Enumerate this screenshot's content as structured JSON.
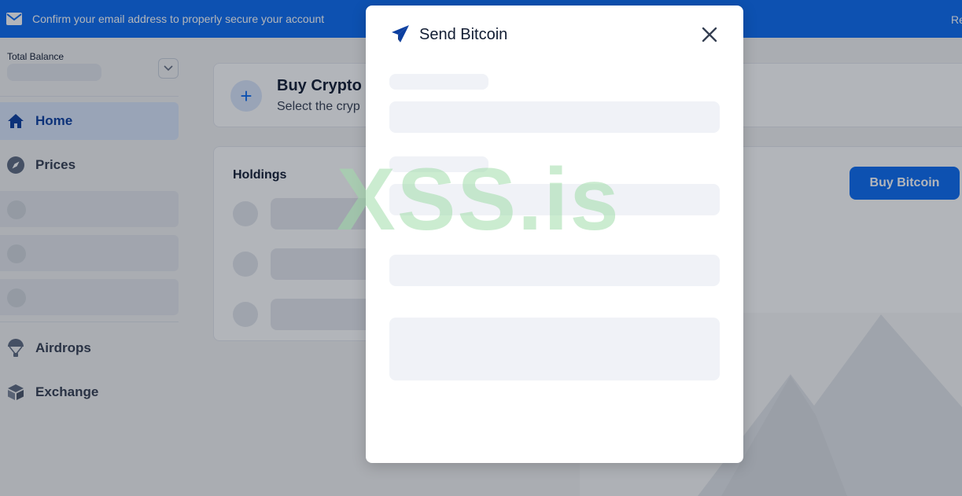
{
  "banner": {
    "message": "Confirm your email address to properly secure your account",
    "right_text": "Re"
  },
  "sidebar": {
    "total_balance_label": "Total Balance",
    "items": [
      {
        "label": "Home",
        "icon": "home-icon",
        "active": true
      },
      {
        "label": "Prices",
        "icon": "compass-icon",
        "active": false
      },
      {
        "label": "Airdrops",
        "icon": "parachute-icon",
        "active": false
      },
      {
        "label": "Exchange",
        "icon": "exchange-icon",
        "active": false
      }
    ]
  },
  "main": {
    "buy_card": {
      "title": "Buy Crypto",
      "subtitle": "Select the cryp"
    },
    "holdings": {
      "title": "Holdings"
    },
    "buy_bitcoin_label": "Buy Bitcoin"
  },
  "modal": {
    "title": "Send Bitcoin",
    "icon": "paper-plane-icon",
    "close_icon": "close-icon"
  },
  "watermark": "XSS.is",
  "colors": {
    "brand_blue": "#0c6cf2",
    "navy": "#121d33",
    "skeleton": "#f0f2f7"
  }
}
